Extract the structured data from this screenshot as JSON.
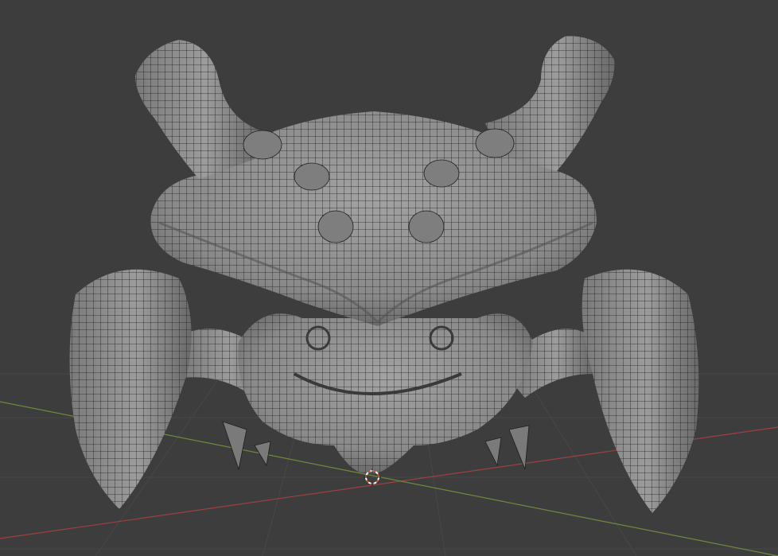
{
  "viewport": {
    "background_color": "#3d3d3d",
    "grid_line_color": "#474747",
    "x_axis_color": "#a04040",
    "y_axis_color": "#6e8a3c",
    "mesh_fill_color": "#8f8f8f",
    "mesh_shadow_color": "#5a5a5a",
    "mesh_wire_color": "#1e1e1e"
  },
  "scene": {
    "object": "creature-mesh",
    "shading": "solid-with-wireframe",
    "cursor_icon": "3d-cursor-icon"
  }
}
